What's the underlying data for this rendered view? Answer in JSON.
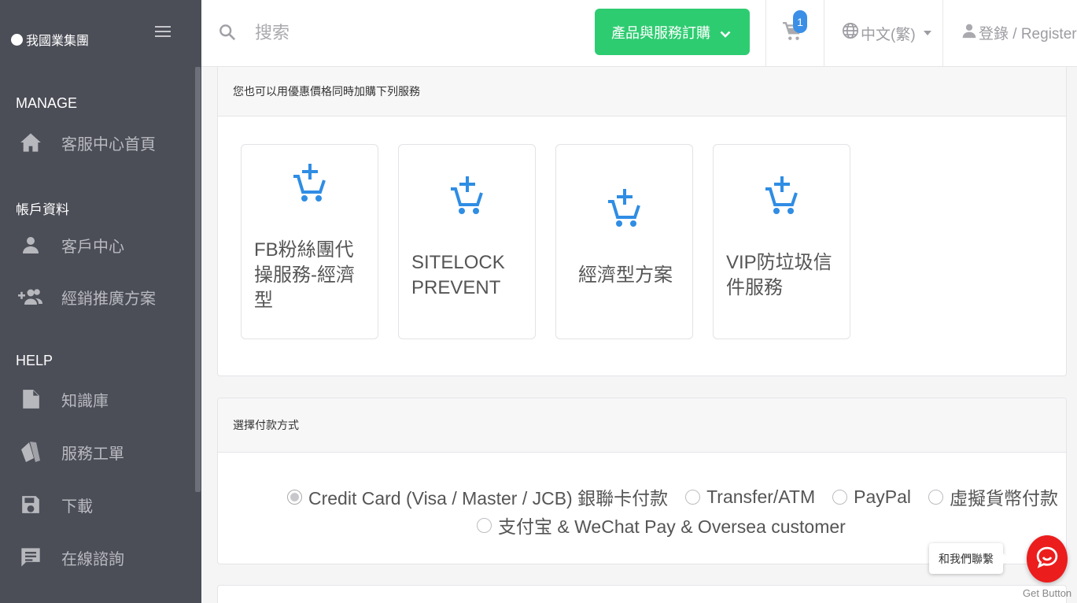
{
  "brand": {
    "name": "我國業集團"
  },
  "sidebar": {
    "sections": {
      "manage": "MANAGE",
      "account": "帳戶資料",
      "help": "HELP"
    },
    "items": [
      {
        "label": "客服中心首頁",
        "icon": "home-icon"
      },
      {
        "label": "客戶中心",
        "icon": "user-icon"
      },
      {
        "label": "經銷推廣方案",
        "icon": "users-add-icon"
      },
      {
        "label": "知識庫",
        "icon": "file-icon"
      },
      {
        "label": "服務工單",
        "icon": "tickets-icon"
      },
      {
        "label": "下載",
        "icon": "floppy-icon"
      },
      {
        "label": "在線諮詢",
        "icon": "chat-icon"
      }
    ]
  },
  "header": {
    "search_placeholder": "搜索",
    "order_button": "產品與服務訂購",
    "cart_count": "1",
    "language": "中文(繁)",
    "login": "登錄 / Register"
  },
  "addons": {
    "title": "您也可以用優惠價格同時加購下列服務",
    "items": [
      {
        "name": "FB粉絲團代操服務-經濟型"
      },
      {
        "name": "SITELOCK PREVENT"
      },
      {
        "name": "經濟型方案"
      },
      {
        "name": "VIP防垃圾信件服務"
      }
    ]
  },
  "payment": {
    "title": "選擇付款方式",
    "options": [
      {
        "label": "Credit Card (Visa / Master / JCB) 銀聯卡付款",
        "selected": true
      },
      {
        "label": "Transfer/ATM",
        "selected": false
      },
      {
        "label": "PayPal",
        "selected": false
      },
      {
        "label": "虛擬貨幣付款",
        "selected": false
      },
      {
        "label": "支付宝 & WeChat Pay & Oversea customer",
        "selected": false
      }
    ]
  },
  "chat": {
    "tooltip": "和我們聯繫",
    "caption": "Get Button"
  },
  "colors": {
    "sidebar_bg": "#4b4d57",
    "accent_green": "#2ecc71",
    "accent_blue": "#3b8fe6",
    "chat_red": "#ec1d1d"
  }
}
